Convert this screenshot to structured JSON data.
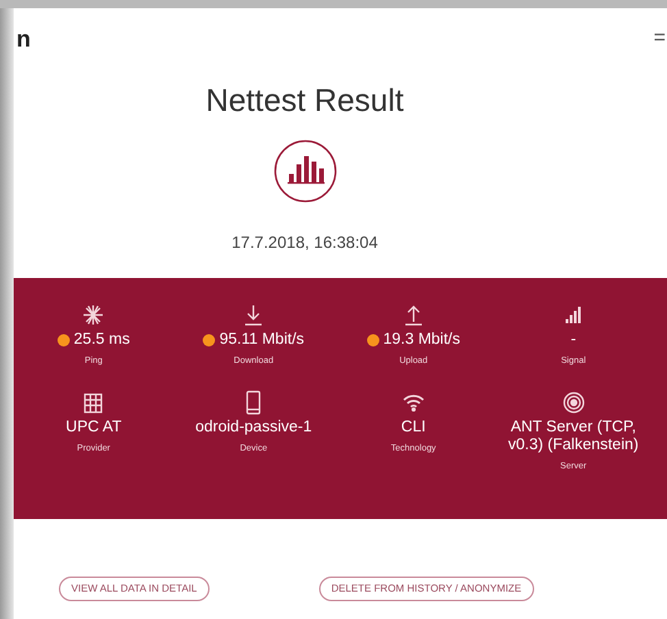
{
  "header": {
    "logo_fragment": "n",
    "menu_glyph": "="
  },
  "title": "Nettest Result",
  "timestamp": "17.7.2018, 16:38:04",
  "metrics": [
    {
      "kind": "ping",
      "value": "25.5 ms",
      "label": "Ping",
      "color": "#f7941d"
    },
    {
      "kind": "download",
      "value": "95.11 Mbit/s",
      "label": "Download",
      "color": "#f7941d"
    },
    {
      "kind": "upload",
      "value": "19.3 Mbit/s",
      "label": "Upload",
      "color": "#f7941d"
    },
    {
      "kind": "signal",
      "value": "-",
      "label": "Signal"
    },
    {
      "kind": "provider",
      "value": "UPC AT",
      "label": "Provider"
    },
    {
      "kind": "device",
      "value": "odroid-passive-1",
      "label": "Device"
    },
    {
      "kind": "wifi",
      "value": "CLI",
      "label": "Technology"
    },
    {
      "kind": "server",
      "value": "ANT Server (TCP, v0.3) (Falkenstein)",
      "label": "Server"
    }
  ],
  "buttons": [
    "VIEW ALL DATA IN DETAIL",
    "DELETE FROM HISTORY / ANONYMIZE"
  ]
}
